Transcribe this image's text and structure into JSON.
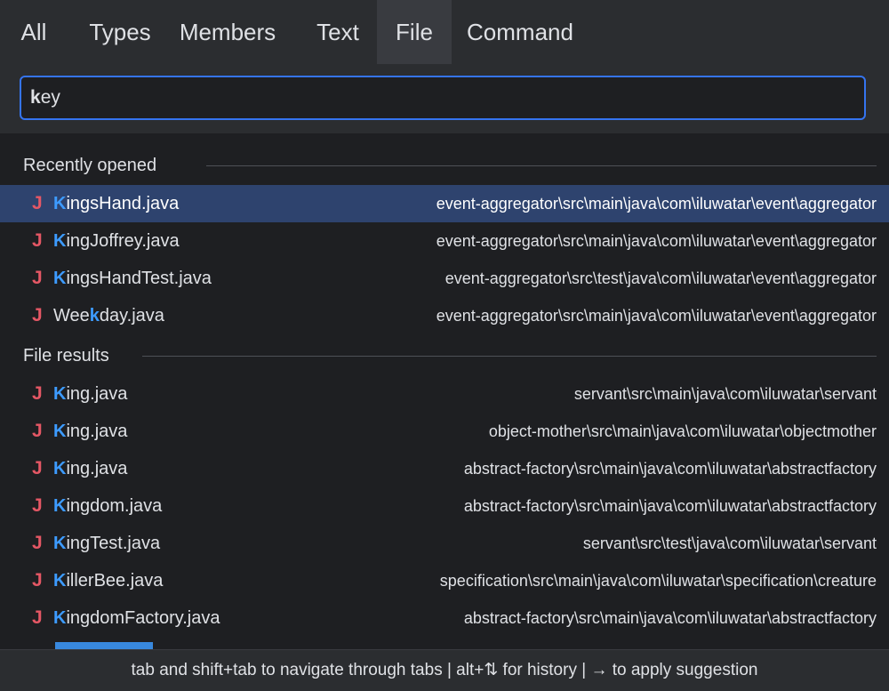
{
  "tabs": [
    {
      "label": "All"
    },
    {
      "label": "Types"
    },
    {
      "label": "Members"
    },
    {
      "label": "Text"
    },
    {
      "label": "File"
    },
    {
      "label": "Command"
    }
  ],
  "active_tab": "File",
  "search": {
    "value_match": "k",
    "value_rest": "ey"
  },
  "sections": {
    "recent": "Recently opened",
    "files": "File results"
  },
  "recent": [
    {
      "pre": "",
      "match": "K",
      "post": "ingsHand.java",
      "path": "event-aggregator\\src\\main\\java\\com\\iluwatar\\event\\aggregator",
      "selected": true
    },
    {
      "pre": "",
      "match": "K",
      "post": "ingJoffrey.java",
      "path": "event-aggregator\\src\\main\\java\\com\\iluwatar\\event\\aggregator"
    },
    {
      "pre": "",
      "match": "K",
      "post": "ingsHandTest.java",
      "path": "event-aggregator\\src\\test\\java\\com\\iluwatar\\event\\aggregator"
    },
    {
      "pre": "Wee",
      "match": "k",
      "post": "day.java",
      "path": "event-aggregator\\src\\main\\java\\com\\iluwatar\\event\\aggregator"
    }
  ],
  "results": [
    {
      "pre": "",
      "match": "K",
      "post": "ing.java",
      "path": "servant\\src\\main\\java\\com\\iluwatar\\servant"
    },
    {
      "pre": "",
      "match": "K",
      "post": "ing.java",
      "path": "object-mother\\src\\main\\java\\com\\iluwatar\\objectmother"
    },
    {
      "pre": "",
      "match": "K",
      "post": "ing.java",
      "path": "abstract-factory\\src\\main\\java\\com\\iluwatar\\abstractfactory"
    },
    {
      "pre": "",
      "match": "K",
      "post": "ingdom.java",
      "path": "abstract-factory\\src\\main\\java\\com\\iluwatar\\abstractfactory"
    },
    {
      "pre": "",
      "match": "K",
      "post": "ingTest.java",
      "path": "servant\\src\\test\\java\\com\\iluwatar\\servant"
    },
    {
      "pre": "",
      "match": "K",
      "post": "illerBee.java",
      "path": "specification\\src\\main\\java\\com\\iluwatar\\specification\\creature"
    },
    {
      "pre": "",
      "match": "K",
      "post": "ingdomFactory.java",
      "path": "abstract-factory\\src\\main\\java\\com\\iluwatar\\abstractfactory"
    }
  ],
  "file_icon": {
    "name": "java-file-icon",
    "glyph": "J",
    "color": "#e55765"
  },
  "match_color": "#3d9bff",
  "selection_color": "#2e436e",
  "footer": "tab and shift+tab to navigate through tabs  |  alt+⇅ for history  |  → to apply suggestion"
}
